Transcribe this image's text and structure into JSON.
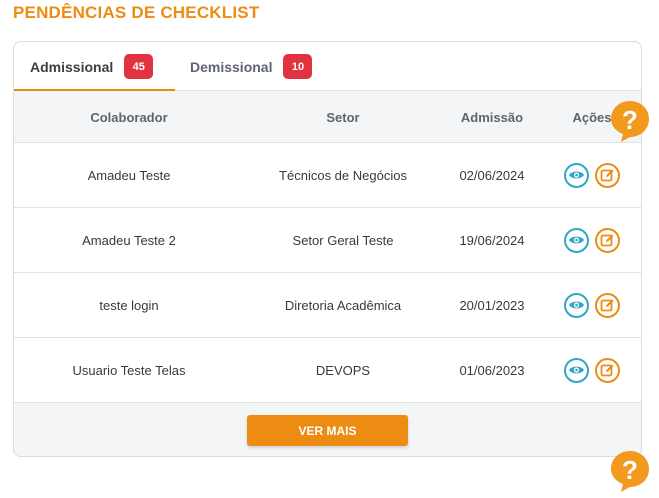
{
  "page": {
    "title": "PENDÊNCIAS DE CHECKLIST"
  },
  "tabs": [
    {
      "label": "Admissional",
      "count": "45",
      "active": true
    },
    {
      "label": "Demissional",
      "count": "10",
      "active": false
    }
  ],
  "table": {
    "headers": {
      "colaborador": "Colaborador",
      "setor": "Setor",
      "admissao": "Admissão",
      "acoes": "Ações"
    },
    "rows": [
      {
        "colaborador": "Amadeu Teste",
        "setor": "Técnicos de Negócios",
        "admissao": "02/06/2024"
      },
      {
        "colaborador": "Amadeu Teste 2",
        "setor": "Setor Geral Teste",
        "admissao": "19/06/2024"
      },
      {
        "colaborador": "teste login",
        "setor": "Diretoria Acadêmica",
        "admissao": "20/01/2023"
      },
      {
        "colaborador": "Usuario Teste Telas",
        "setor": "DEVOPS",
        "admissao": "01/06/2023"
      }
    ]
  },
  "footer": {
    "ver_mais_label": "VER MAIS"
  },
  "icons": {
    "view": "eye-icon",
    "edit": "edit-icon",
    "help": "help-icon"
  },
  "colors": {
    "accent": "#ec8c12",
    "badge": "#e0323f",
    "view_icon": "#2fa6c9"
  }
}
